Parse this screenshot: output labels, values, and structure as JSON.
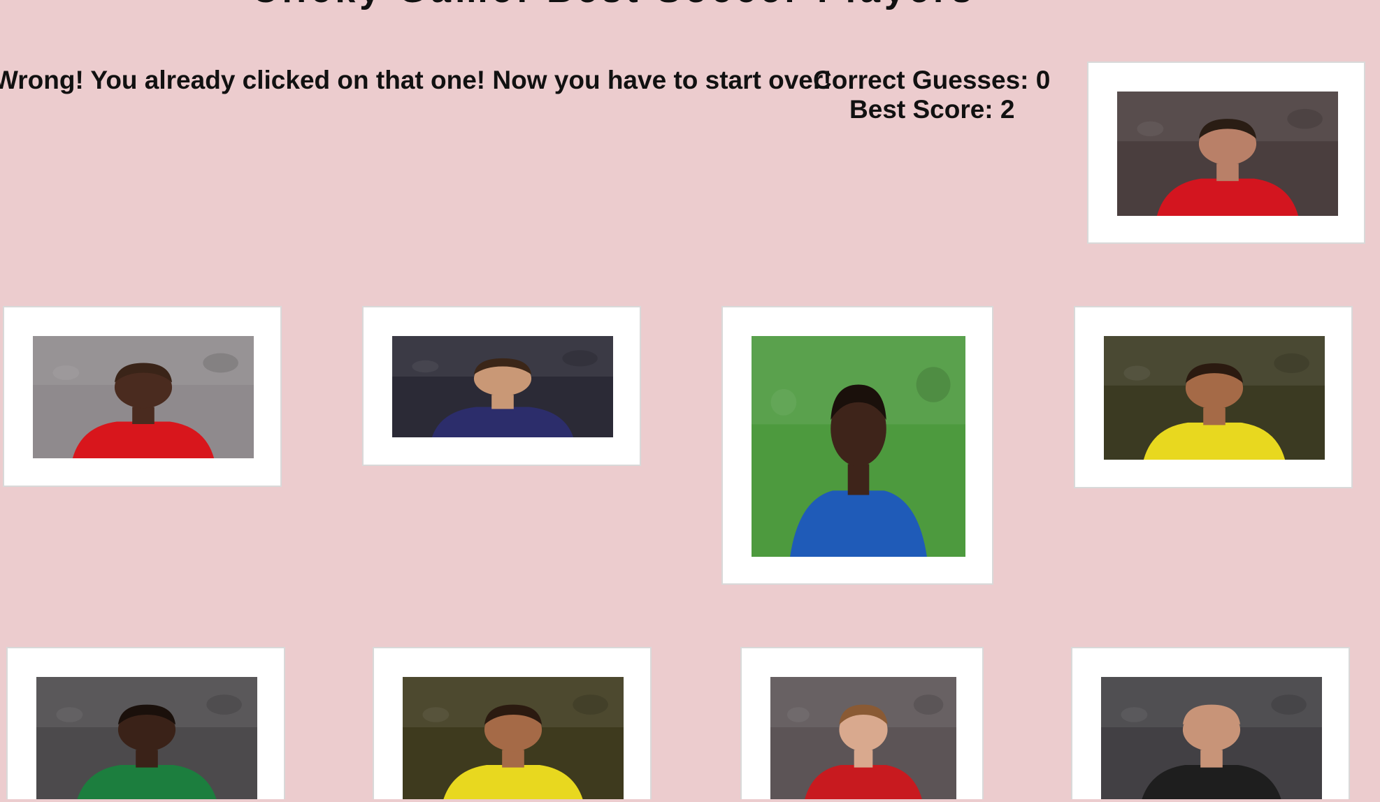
{
  "header": {
    "title": "Clicky Game: Best Soccer Players"
  },
  "status": {
    "message": "Wrong! You already clicked on that one! Now you have to start over!",
    "correct_label": "Correct Guesses: 0",
    "best_label": "Best Score: 2"
  },
  "cards": [
    {
      "icon": "player-photo-zlatan-ibrahimovic",
      "jersey": "#d3151f",
      "skin": "#b98068",
      "hair": "#2a1d14",
      "bg": "#4a3e3e"
    },
    {
      "icon": "player-photo-el-hadji-diouf",
      "jersey": "#d8161c",
      "skin": "#4a2b1f",
      "hair": "#3a2418",
      "bg": "#8f8a8d"
    },
    {
      "icon": "player-photo-lionel-messi",
      "jersey": "#2c2d6b",
      "skin": "#c99876",
      "hair": "#3b2618",
      "bg": "#2b2a36"
    },
    {
      "icon": "player-photo-didier-drogba",
      "jersey": "#1f5bb8",
      "skin": "#3e241a",
      "hair": "#1a100b",
      "bg": "#4d9a3e"
    },
    {
      "icon": "player-photo-ronaldo-nazario",
      "jersey": "#e8d81f",
      "skin": "#a56a47",
      "hair": "#2b1a10",
      "bg": "#3b3a22"
    },
    {
      "icon": "player-photo-samuel-etoo",
      "jersey": "#1c7e3e",
      "skin": "#3a2218",
      "hair": "#1a100b",
      "bg": "#4c4a4c"
    },
    {
      "icon": "player-photo-ronaldo-brazil",
      "jersey": "#e8d81f",
      "skin": "#a56a47",
      "hair": "#2b1a10",
      "bg": "#3e3a1e"
    },
    {
      "icon": "player-photo-david-beckham",
      "jersey": "#c81a1f",
      "skin": "#d9a98e",
      "hair": "#8a5a34",
      "bg": "#5c5456"
    },
    {
      "icon": "player-photo-zinedine-zidane",
      "jersey": "#1e1e1e",
      "skin": "#c89478",
      "hair": "#c89478",
      "bg": "#424044"
    }
  ]
}
